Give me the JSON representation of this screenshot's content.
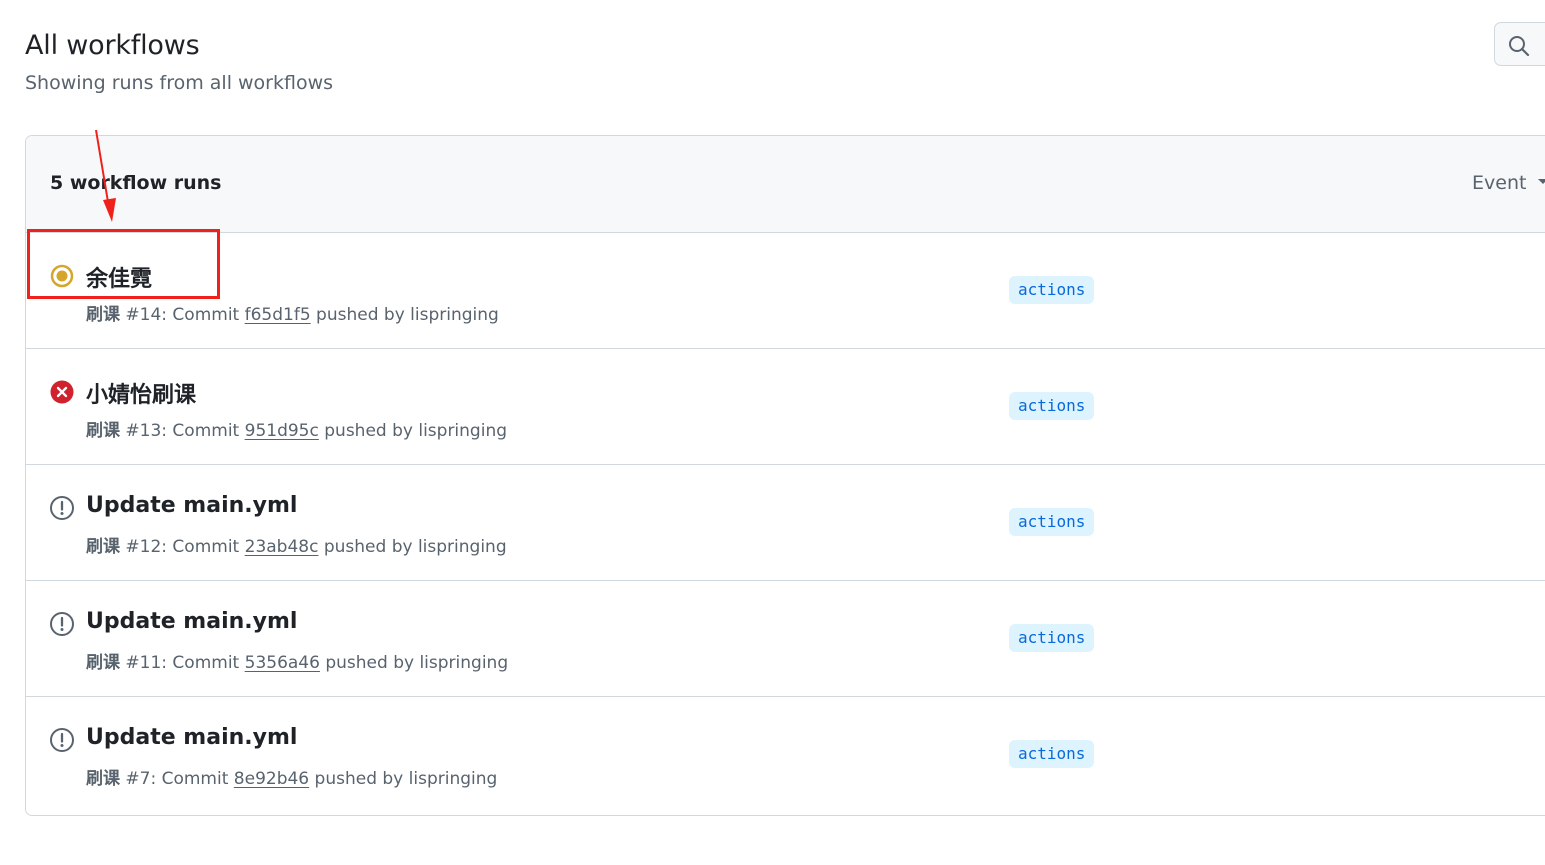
{
  "header": {
    "title": "All workflows",
    "subtitle": "Showing runs from all workflows"
  },
  "search": {
    "icon": "search-icon"
  },
  "runs_list": {
    "count_label": "5 workflow runs",
    "event_filter_label": "Event",
    "runs": [
      {
        "status": "in-progress",
        "title": "余佳霓",
        "workflow": "刷课",
        "number": "#14",
        "commit_prefix": ": Commit ",
        "commit": "f65d1f5",
        "pushed_by": " pushed by lispringing",
        "event": "actions"
      },
      {
        "status": "failure",
        "title": "小婧怡刷课",
        "workflow": "刷课",
        "number": "#13",
        "commit_prefix": ": Commit ",
        "commit": "951d95c",
        "pushed_by": " pushed by lispringing",
        "event": "actions"
      },
      {
        "status": "startup-failure",
        "title": "Update main.yml",
        "workflow": "刷课",
        "number": "#12",
        "commit_prefix": ": Commit ",
        "commit": "23ab48c",
        "pushed_by": " pushed by lispringing",
        "event": "actions"
      },
      {
        "status": "startup-failure",
        "title": "Update main.yml",
        "workflow": "刷课",
        "number": "#11",
        "commit_prefix": ": Commit ",
        "commit": "5356a46",
        "pushed_by": " pushed by lispringing",
        "event": "actions"
      },
      {
        "status": "startup-failure",
        "title": "Update main.yml",
        "workflow": "刷课",
        "number": "#7",
        "commit_prefix": ": Commit ",
        "commit": "8e92b46",
        "pushed_by": " pushed by lispringing",
        "event": "actions"
      }
    ]
  },
  "colors": {
    "in_progress": "#d4a72c",
    "failure": "#cf222e",
    "neutral_icon": "#59636e",
    "label_bg": "#ddf4ff",
    "label_fg": "#0969da",
    "annotation": "#f0211d"
  }
}
